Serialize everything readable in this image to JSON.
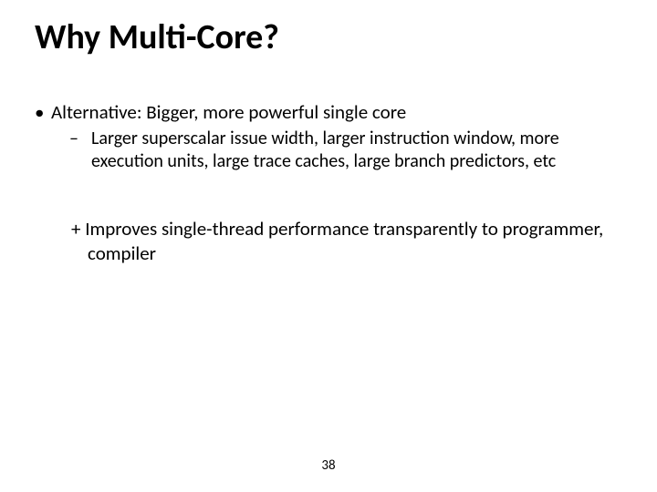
{
  "title": "Why Multi-Core?",
  "bullets": {
    "lvl1": "Alternative: Bigger, more powerful single core",
    "lvl2": "Larger superscalar issue width, larger instruction window, more execution units, large trace caches, large branch predictors, etc",
    "plus": "+ Improves single-thread performance transparently to programmer, compiler"
  },
  "page_number": "38"
}
